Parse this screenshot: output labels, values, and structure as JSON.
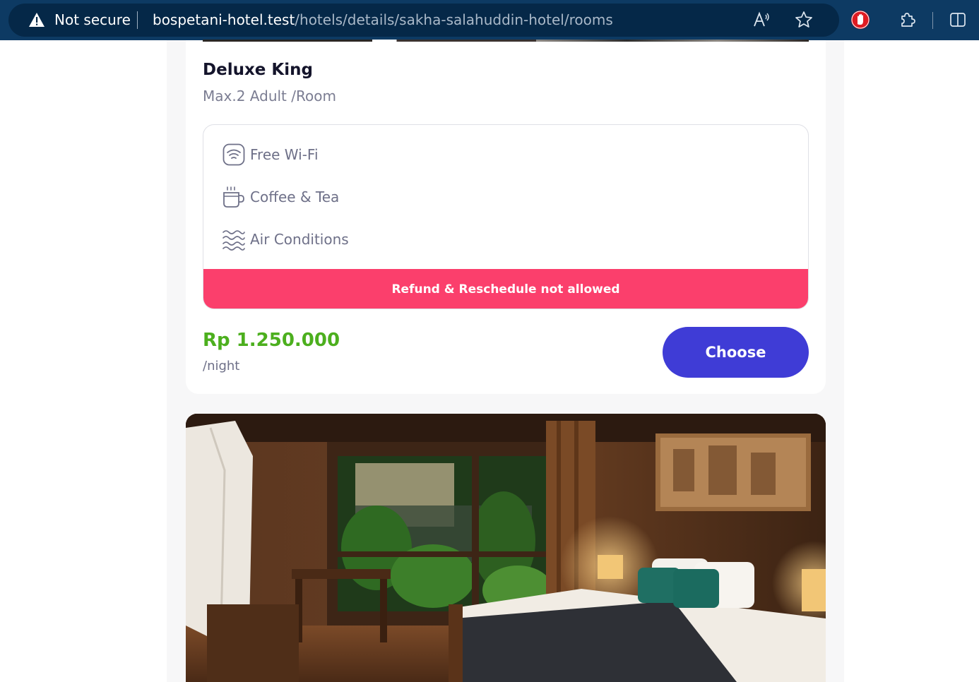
{
  "browser": {
    "security_label": "Not secure",
    "url_host": "bospetani-hotel.test",
    "url_path": "/hotels/details/sakha-salahuddin-hotel/rooms",
    "read_aloud_glyph": "Aͅ",
    "icons": [
      "warning-icon",
      "read-aloud-icon",
      "favorite-star-icon",
      "adblock-hand-icon",
      "extensions-puzzle-icon",
      "split-screen-icon"
    ]
  },
  "room": {
    "name": "Deluxe King",
    "capacity": "Max.2 Adult /Room",
    "facilities": [
      {
        "icon": "wifi-icon",
        "label": "Free Wi-Fi"
      },
      {
        "icon": "coffee-cup-icon",
        "label": "Coffee & Tea"
      },
      {
        "icon": "air-waves-icon",
        "label": "Air Conditions"
      }
    ],
    "refund_notice": "Refund & Reschedule not allowed",
    "price": "Rp 1.250.000",
    "price_unit": "/night",
    "choose_label": "Choose"
  },
  "colors": {
    "browser_bar": "#0d3a63",
    "refund_banner": "#fb3f6c",
    "price": "#4caf1e",
    "choose_button": "#3f3cd6"
  }
}
